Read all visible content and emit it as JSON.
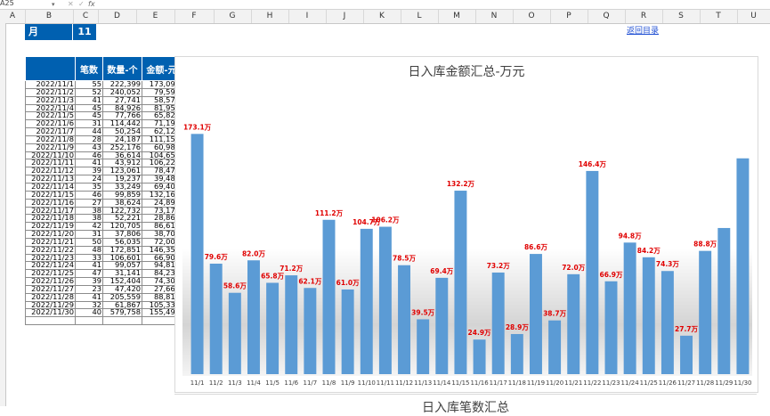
{
  "formula_bar": {
    "name_box": "A25",
    "fx": "fx"
  },
  "columns": [
    "A",
    "B",
    "C",
    "D",
    "E",
    "F",
    "G",
    "H",
    "I",
    "J",
    "K",
    "L",
    "M",
    "N",
    "O",
    "P",
    "Q",
    "R",
    "S",
    "T",
    "U"
  ],
  "month": {
    "label": "月",
    "value": "11月"
  },
  "return_link": "返回目录",
  "table": {
    "headers": [
      "",
      "笔数",
      "数量-个",
      "金额-元"
    ],
    "rows": [
      [
        "2022/11/1",
        "55",
        "222,399",
        "173,095"
      ],
      [
        "2022/11/2",
        "52",
        "240,052",
        "79,594"
      ],
      [
        "2022/11/3",
        "41",
        "27,741",
        "58,571"
      ],
      [
        "2022/11/4",
        "45",
        "84,926",
        "81,953"
      ],
      [
        "2022/11/5",
        "45",
        "77,766",
        "65,827"
      ],
      [
        "2022/11/6",
        "31",
        "114,442",
        "71,194"
      ],
      [
        "2022/11/7",
        "44",
        "50,254",
        "62,124"
      ],
      [
        "2022/11/8",
        "28",
        "24,187",
        "111,154"
      ],
      [
        "2022/11/9",
        "43",
        "252,176",
        "60,987"
      ],
      [
        "2022/11/10",
        "46",
        "36,614",
        "104,654"
      ],
      [
        "2022/11/11",
        "41",
        "43,912",
        "106,222"
      ],
      [
        "2022/11/12",
        "39",
        "123,061",
        "78,472"
      ],
      [
        "2022/11/13",
        "24",
        "19,237",
        "39,480"
      ],
      [
        "2022/11/14",
        "35",
        "33,249",
        "69,401"
      ],
      [
        "2022/11/15",
        "46",
        "99,859",
        "132,168"
      ],
      [
        "2022/11/16",
        "27",
        "38,624",
        "24,897"
      ],
      [
        "2022/11/17",
        "38",
        "122,732",
        "73,170"
      ],
      [
        "2022/11/18",
        "38",
        "52,221",
        "28,865"
      ],
      [
        "2022/11/19",
        "42",
        "120,705",
        "86,613"
      ],
      [
        "2022/11/20",
        "31",
        "37,806",
        "38,708"
      ],
      [
        "2022/11/21",
        "50",
        "56,035",
        "72,008"
      ],
      [
        "2022/11/22",
        "48",
        "172,851",
        "146,356"
      ],
      [
        "2022/11/23",
        "33",
        "106,601",
        "66,908"
      ],
      [
        "2022/11/24",
        "41",
        "99,057",
        "94,811"
      ],
      [
        "2022/11/25",
        "47",
        "31,141",
        "84,239"
      ],
      [
        "2022/11/26",
        "39",
        "152,404",
        "74,306"
      ],
      [
        "2022/11/27",
        "23",
        "47,420",
        "27,661"
      ],
      [
        "2022/11/28",
        "41",
        "205,559",
        "88,815"
      ],
      [
        "2022/11/29",
        "32",
        "61,867",
        "105,339"
      ],
      [
        "2022/11/30",
        "40",
        "579,758",
        "155,490"
      ]
    ]
  },
  "chart_data": {
    "type": "bar",
    "title": "日入库金额汇总-万元",
    "categories": [
      "11/1",
      "11/2",
      "11/3",
      "11/4",
      "11/5",
      "11/6",
      "11/7",
      "11/8",
      "11/9",
      "11/10",
      "11/11",
      "11/12",
      "11/13",
      "11/14",
      "11/15",
      "11/16",
      "11/17",
      "11/18",
      "11/19",
      "11/20",
      "11/21",
      "11/22",
      "11/23",
      "11/24",
      "11/25",
      "11/26",
      "11/27",
      "11/28",
      "11/29",
      "11/30"
    ],
    "values": [
      173.1,
      79.6,
      58.6,
      82.0,
      65.8,
      71.2,
      62.1,
      111.2,
      61.0,
      104.7,
      106.2,
      78.5,
      39.5,
      69.4,
      132.2,
      24.9,
      73.2,
      28.9,
      86.6,
      38.7,
      72.0,
      146.4,
      66.9,
      94.8,
      84.2,
      74.3,
      27.7,
      88.8,
      105.3,
      155.5
    ],
    "labels": [
      "173.1万",
      "79.6万",
      "58.6万",
      "82.0万",
      "65.8万",
      "71.2万",
      "62.1万",
      "111.2万",
      "61.0万",
      "104.7万",
      "106.2万",
      "78.5万",
      "39.5万",
      "69.4万",
      "132.2万",
      "24.9万",
      "73.2万",
      "28.9万",
      "86.6万",
      "38.7万",
      "72.0万",
      "146.4万",
      "66.9万",
      "94.8万",
      "84.2万",
      "74.3万",
      "27.7万",
      "88.8万",
      "",
      ""
    ],
    "ylim": [
      0,
      190
    ],
    "bar_color": "#5b9bd5",
    "label_color": "#e00000"
  },
  "chart2": {
    "title": "日入库笔数汇总"
  }
}
